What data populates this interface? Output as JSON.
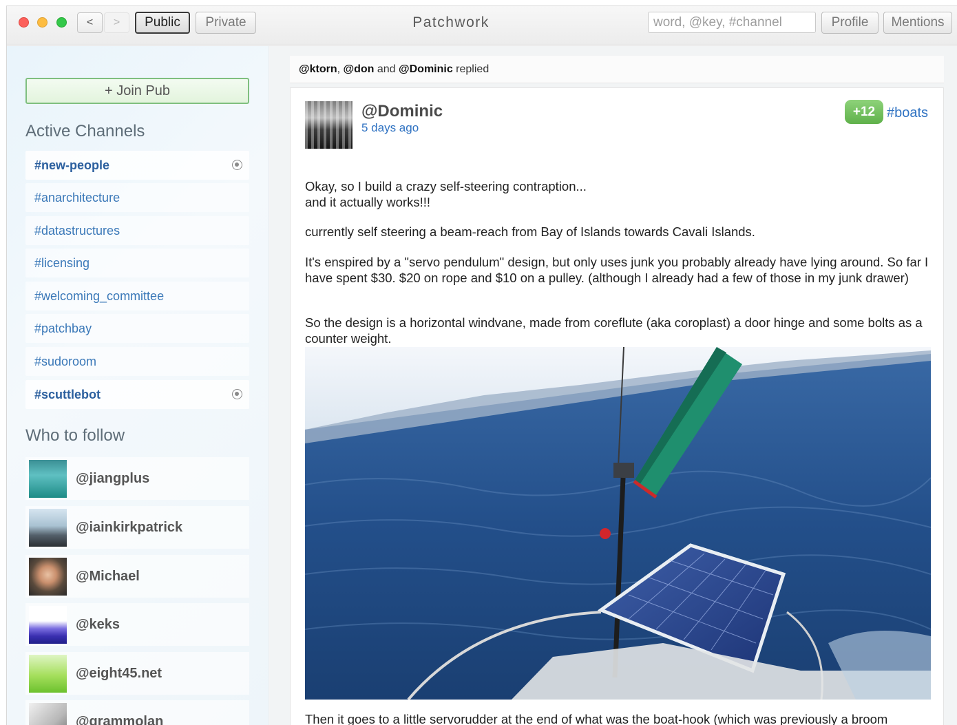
{
  "window": {
    "title": "Patchwork"
  },
  "toolbar": {
    "back": "<",
    "forward": ">",
    "public_label": "Public",
    "private_label": "Private",
    "search_placeholder": "word, @key, #channel",
    "profile_label": "Profile",
    "mentions_label": "Mentions"
  },
  "sidebar": {
    "join_pub_label": "+ Join Pub",
    "channels_title": "Active Channels",
    "channels": [
      {
        "name": "#new-people",
        "pinned": true
      },
      {
        "name": "#anarchitecture",
        "pinned": false
      },
      {
        "name": "#datastructures",
        "pinned": false
      },
      {
        "name": "#licensing",
        "pinned": false
      },
      {
        "name": "#welcoming_committee",
        "pinned": false
      },
      {
        "name": "#patchbay",
        "pinned": false
      },
      {
        "name": "#sudoroom",
        "pinned": false
      },
      {
        "name": "#scuttlebot",
        "pinned": true
      }
    ],
    "follow_title": "Who to follow",
    "follow": [
      {
        "name": "@jiangplus"
      },
      {
        "name": "@iainkirkpatrick"
      },
      {
        "name": "@Michael"
      },
      {
        "name": "@keks"
      },
      {
        "name": "@eight45.net"
      },
      {
        "name": "@grammolan"
      }
    ]
  },
  "feed": {
    "notice": {
      "user1": "@ktorn",
      "sep1": ", ",
      "user2": "@don",
      "sep2": " and ",
      "user3": "@Dominic",
      "suffix": " replied"
    },
    "post": {
      "author": "@Dominic",
      "timestamp": "5 days ago",
      "votes": "+12",
      "channel": "#boats",
      "line1": "Okay, so I build a crazy self-steering contraption...",
      "line2": "and it actually works!!!",
      "para2": "currently self steering a beam-reach from Bay of Islands towards Cavali Islands.",
      "para3": "It's enspired by a \"servo pendulum\" design, but only uses junk you probably already have lying around. So far I have spent $30. $20 on rope and $10 on a pulley. (although I already had a few of those in my junk drawer)",
      "para4": "So the design is a horizontal windvane, made from coreflute (aka coroplast) a door hinge and some bolts as a counter weight.",
      "para5": "Then it goes to a little servorudder at the end of what was the boat-hook (which was previously a broom"
    }
  },
  "colors": {
    "link": "#2f72c2",
    "join_border": "#7fbf7f",
    "vote_badge": "#6bbf56"
  }
}
